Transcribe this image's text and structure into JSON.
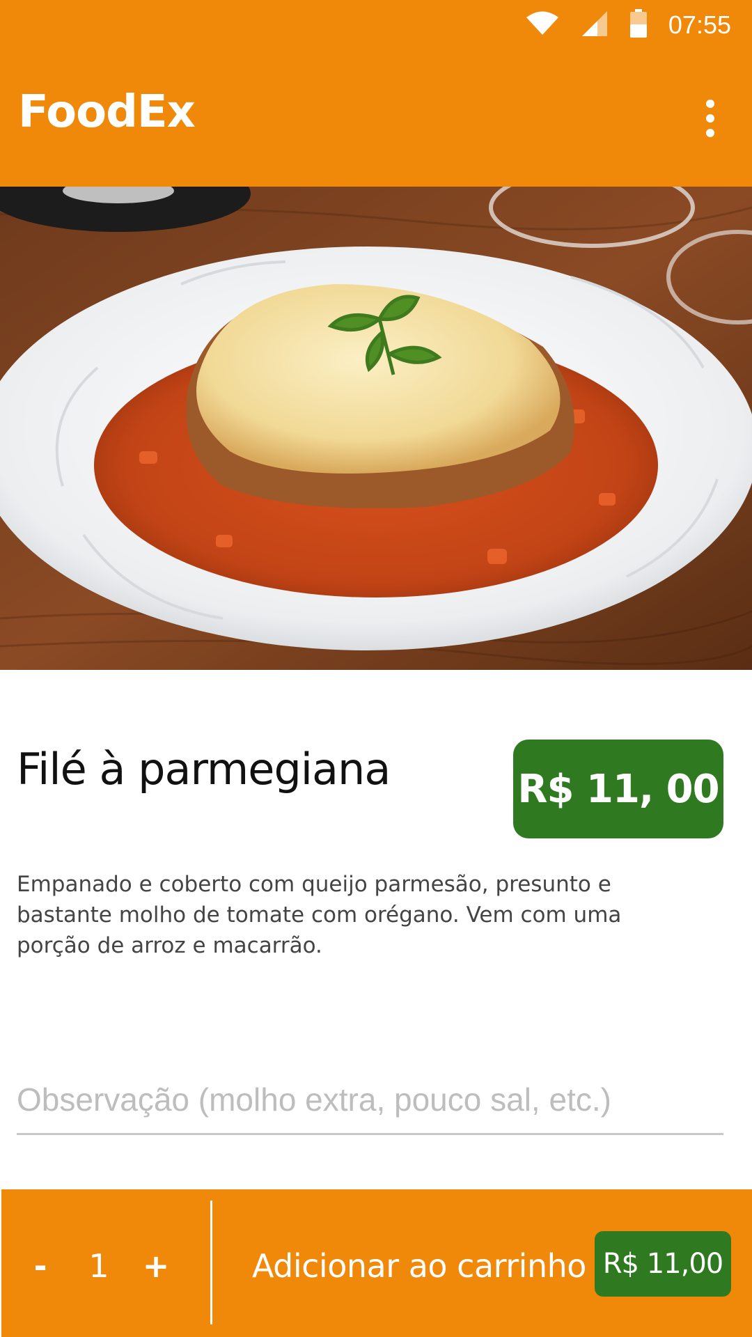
{
  "status_bar": {
    "time": "07:55",
    "icons": [
      "wifi-icon",
      "signal-icon",
      "battery-icon"
    ]
  },
  "app_bar": {
    "title": "FoodEx",
    "menu_icon": "more-vert-icon"
  },
  "hero_image": {
    "alt": "Filé à parmegiana"
  },
  "dish": {
    "name": "Filé à parmegiana",
    "price": "R$ 11, 00",
    "description": "Empanado e coberto com queijo parmesão, presunto e bastante molho de tomate com orégano. Vem com uma porção de arroz e macarrão."
  },
  "observation": {
    "value": "",
    "placeholder": "Observação (molho extra, pouco sal, etc.)"
  },
  "cart_bar": {
    "minus_label": "-",
    "quantity": "1",
    "plus_label": "+",
    "add_label": "Adicionar ao carrinho",
    "total": "R$ 11,00"
  },
  "colors": {
    "brand": "#f0890a",
    "price_badge": "#2f7a20",
    "text_primary": "#111111",
    "text_secondary": "#444444",
    "placeholder": "#bdbdbd"
  }
}
